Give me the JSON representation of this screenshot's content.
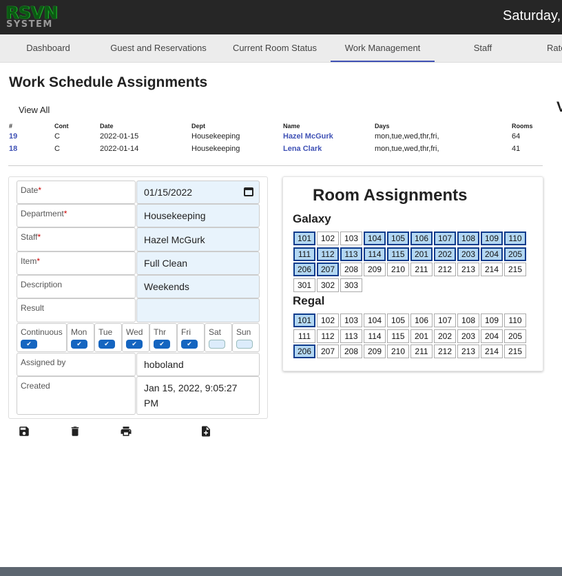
{
  "header": {
    "logo_top": "RSVN",
    "logo_bottom": "SYSTEM",
    "date": "Saturday, Ja"
  },
  "tabs": [
    {
      "label": "Dashboard"
    },
    {
      "label": "Guest and Reservations"
    },
    {
      "label": "Current Room Status"
    },
    {
      "label": "Work Management",
      "active": true
    },
    {
      "label": "Staff"
    },
    {
      "label": "Rate"
    }
  ],
  "page": {
    "title": "Work Schedule Assignments",
    "view_all": "View All",
    "side_letter": "V"
  },
  "table": {
    "headers": [
      "#",
      "Cont",
      "Date",
      "Dept",
      "Name",
      "Days",
      "Rooms"
    ],
    "rows": [
      [
        "19",
        "C",
        "2022-01-15",
        "Housekeeping",
        "Hazel McGurk",
        "mon,tue,wed,thr,fri,",
        "64"
      ],
      [
        "18",
        "C",
        "2022-01-14",
        "Housekeeping",
        "Lena Clark",
        "mon,tue,wed,thr,fri,",
        "41"
      ]
    ]
  },
  "form": {
    "date": {
      "label": "Date",
      "value": "01/15/2022"
    },
    "department": {
      "label": "Department",
      "value": "Housekeeping"
    },
    "staff": {
      "label": "Staff",
      "value": "Hazel McGurk"
    },
    "item": {
      "label": "Item",
      "value": "Full Clean"
    },
    "description": {
      "label": "Description",
      "value": "Weekends"
    },
    "result": {
      "label": "Result",
      "value": ""
    },
    "required_mark": "*",
    "days": [
      {
        "label": "Continuous",
        "checked": true
      },
      {
        "label": "Mon",
        "checked": true
      },
      {
        "label": "Tue",
        "checked": true
      },
      {
        "label": "Wed",
        "checked": true
      },
      {
        "label": "Thr",
        "checked": true
      },
      {
        "label": "Fri",
        "checked": true
      },
      {
        "label": "Sat",
        "checked": false
      },
      {
        "label": "Sun",
        "checked": false
      }
    ],
    "check_glyph": "✔",
    "assigned_by": {
      "label": "Assigned by",
      "value": "hoboland"
    },
    "created": {
      "label": "Created",
      "value": "Jan 15, 2022, 9:05:27 PM"
    }
  },
  "actions": [
    {
      "name": "save-icon"
    },
    {
      "name": "delete-icon"
    },
    {
      "name": "print-icon"
    },
    {
      "name": "new-document-icon"
    }
  ],
  "rooms": {
    "title": "Room Assignments",
    "groups": [
      {
        "name": "Galaxy",
        "rooms": [
          "101",
          "102",
          "103",
          "104",
          "105",
          "106",
          "107",
          "108",
          "109",
          "110",
          "111",
          "112",
          "113",
          "114",
          "115",
          "201",
          "202",
          "203",
          "204",
          "205",
          "206",
          "207",
          "208",
          "209",
          "210",
          "211",
          "212",
          "213",
          "214",
          "215",
          "301",
          "302",
          "303"
        ],
        "selected": [
          "101",
          "104",
          "105",
          "106",
          "107",
          "108",
          "109",
          "110",
          "111",
          "112",
          "113",
          "114",
          "115",
          "201",
          "202",
          "203",
          "204",
          "205",
          "206",
          "207"
        ]
      },
      {
        "name": "Regal",
        "rooms": [
          "101",
          "102",
          "103",
          "104",
          "105",
          "106",
          "107",
          "108",
          "109",
          "110",
          "111",
          "112",
          "113",
          "114",
          "115",
          "201",
          "202",
          "203",
          "204",
          "205",
          "206",
          "207",
          "208",
          "209",
          "210",
          "211",
          "212",
          "213",
          "214",
          "215"
        ],
        "selected": [
          "101",
          "206"
        ]
      }
    ]
  }
}
